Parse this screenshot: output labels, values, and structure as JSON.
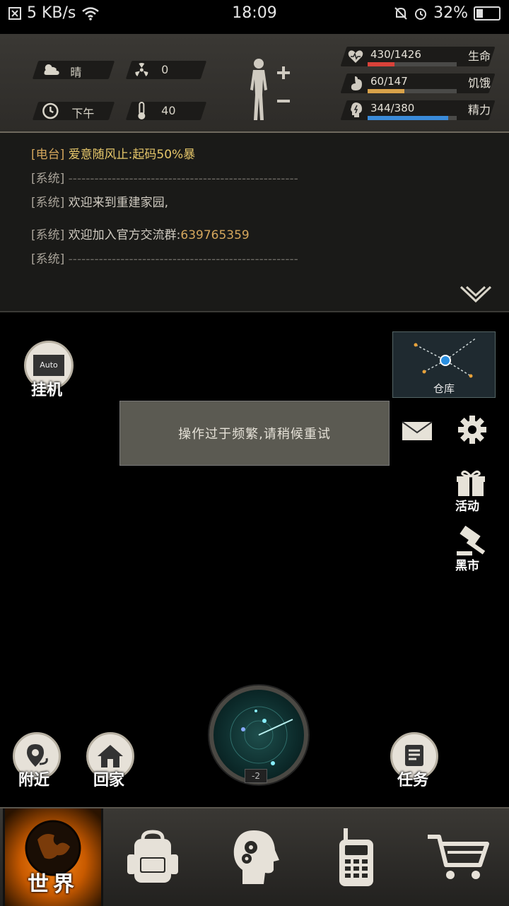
{
  "status_bar": {
    "speed": "5 KB/s",
    "time": "18:09",
    "battery": "32%",
    "battery_level": 0.32
  },
  "hud": {
    "weather": {
      "label": "晴"
    },
    "radiation": {
      "value": "0"
    },
    "time_of_day": {
      "label": "下午"
    },
    "temperature": {
      "value": "40"
    },
    "stats": [
      {
        "name": "生命",
        "value_text": "430/1426",
        "fraction": 0.3,
        "color": "#d9423a",
        "icon": "heart-icon"
      },
      {
        "name": "饥饿",
        "value_text": "60/147",
        "fraction": 0.41,
        "color": "#d9a24a",
        "icon": "stomach-icon"
      },
      {
        "name": "精力",
        "value_text": "344/380",
        "fraction": 0.905,
        "color": "#3a8bd9",
        "icon": "brain-icon"
      }
    ]
  },
  "chat": {
    "lines": [
      {
        "tag": "[电台]",
        "text": "爱意随风止:起码50%暴",
        "type": "radio"
      },
      {
        "tag": "[系统]",
        "text": "-----------------------------------------------------",
        "type": "dash"
      },
      {
        "tag": "[系统]",
        "text": "欢迎来到重建家园,",
        "type": "system"
      },
      {
        "tag": "[系统]",
        "text": " 欢迎加入官方交流群:",
        "highlight": "639765359",
        "type": "system-highlight"
      },
      {
        "tag": "[系统]",
        "text": "-----------------------------------------------------",
        "type": "dash"
      }
    ]
  },
  "left_buttons": {
    "auto_badge": "Auto",
    "auto": "挂机"
  },
  "right_buttons": {
    "warehouse": "仓库",
    "activity": "活动",
    "black_market": "黑市"
  },
  "toast": {
    "message": "操作过于频繁,请稍候重试"
  },
  "radar": {
    "level": "-2"
  },
  "bottom_actions": {
    "nearby": "附近",
    "home": "回家",
    "task": "任务"
  },
  "tabs": {
    "world": "世界"
  },
  "colors": {
    "accent_orange": "#ff8c1a",
    "hud_bg": "#3a3834"
  }
}
